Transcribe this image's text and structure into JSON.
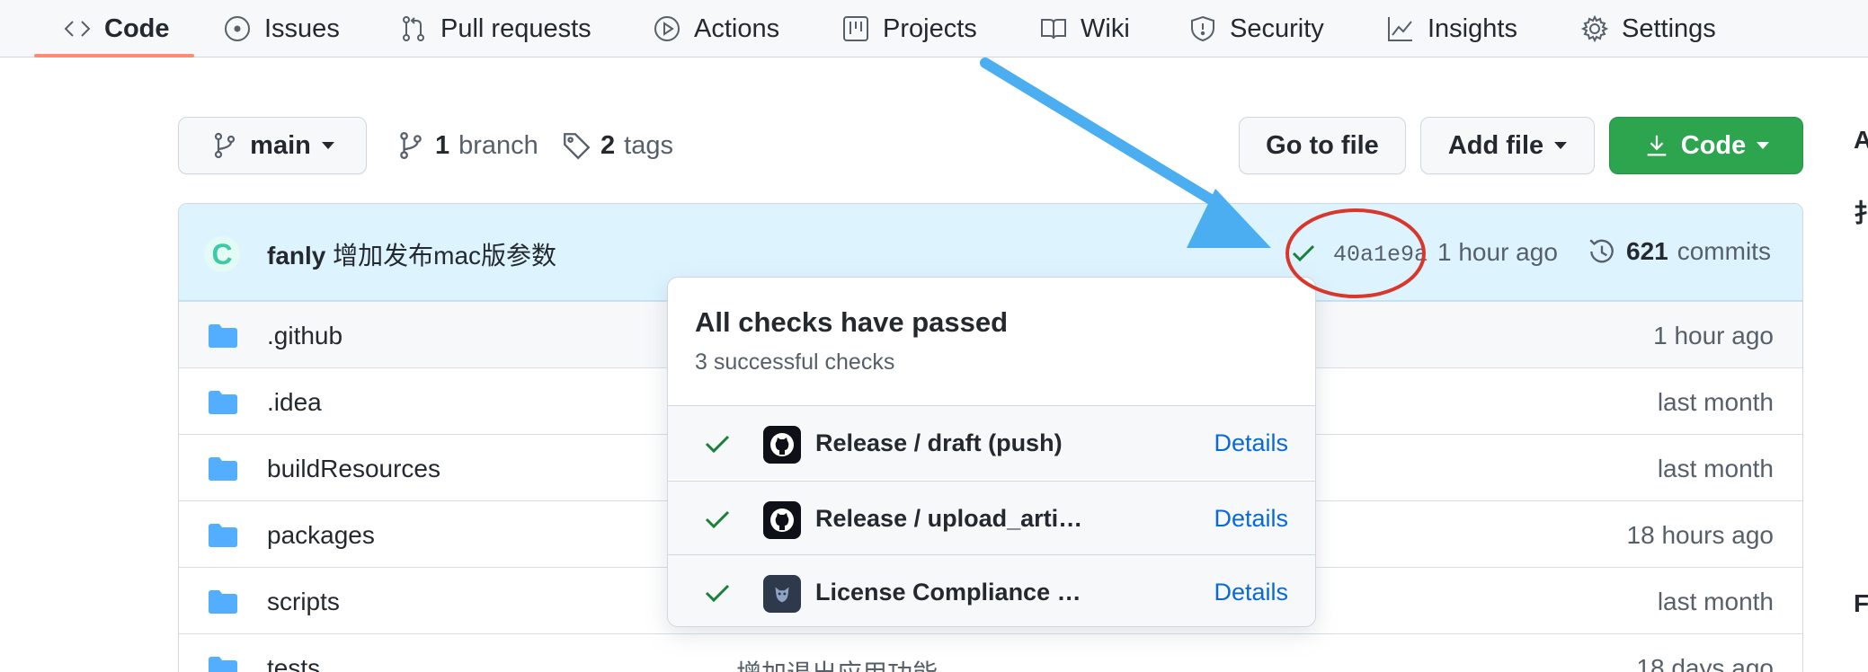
{
  "nav": {
    "items": [
      {
        "label": "Code",
        "icon": "code-icon",
        "active": true
      },
      {
        "label": "Issues",
        "icon": "issue-circle-icon"
      },
      {
        "label": "Pull requests",
        "icon": "pull-request-icon"
      },
      {
        "label": "Actions",
        "icon": "play-circle-icon"
      },
      {
        "label": "Projects",
        "icon": "project-board-icon"
      },
      {
        "label": "Wiki",
        "icon": "book-icon"
      },
      {
        "label": "Security",
        "icon": "shield-icon"
      },
      {
        "label": "Insights",
        "icon": "graph-icon"
      },
      {
        "label": "Settings",
        "icon": "gear-icon"
      }
    ]
  },
  "toolbar": {
    "branch_select": "main",
    "branches_count": "1",
    "branches_label": "branch",
    "tags_count": "2",
    "tags_label": "tags",
    "go_to_file": "Go to file",
    "add_file": "Add file",
    "code": "Code"
  },
  "latest_commit": {
    "avatar_letter": "C",
    "author": "fanly",
    "message": "增加发布mac版参数",
    "sha": "40a1e9a",
    "time": "1 hour ago",
    "commits_count": "621",
    "commits_label": "commits"
  },
  "files": [
    {
      "name": ".github",
      "message": "",
      "time": "1 hour ago"
    },
    {
      "name": ".idea",
      "message": "",
      "time": "last month"
    },
    {
      "name": "buildResources",
      "message": "",
      "time": "last month"
    },
    {
      "name": "packages",
      "message": "",
      "time": "18 hours ago"
    },
    {
      "name": "scripts",
      "message": "",
      "time": "last month"
    },
    {
      "name": "tests",
      "message": "增加退出应用功能",
      "time": "18 days ago"
    }
  ],
  "checks_popover": {
    "title": "All checks have passed",
    "subtitle": "3 successful checks",
    "checks": [
      {
        "name": "Release / draft (push)",
        "action": "Details",
        "icon": "github-octocat-icon"
      },
      {
        "name": "Release / upload_arti…",
        "action": "Details",
        "icon": "github-octocat-icon"
      },
      {
        "name": "License Compliance …",
        "action": "Details",
        "icon": "fossa-icon"
      }
    ]
  },
  "right_edge": {
    "glyph_1": "A",
    "glyph_2": "扌",
    "glyph_3": "F"
  },
  "colors": {
    "accent_underline": "#fd8c73",
    "code_button": "#2da44e",
    "link": "#0969da",
    "check_green": "#1a7f37",
    "folder": "#54aeff",
    "annotation_arrow": "#4aaef0",
    "annotation_circle": "#d9372b"
  }
}
